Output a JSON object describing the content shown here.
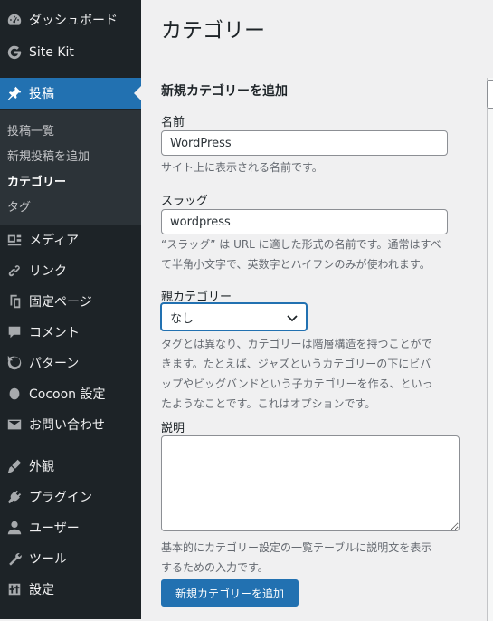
{
  "sidebar": {
    "items": [
      {
        "label": "ダッシュボード",
        "icon": "dashboard-icon"
      },
      {
        "label": "Site Kit",
        "icon": "sitekit-icon"
      },
      {
        "label": "投稿",
        "icon": "pin-icon",
        "active": true
      },
      {
        "label": "メディア",
        "icon": "media-icon"
      },
      {
        "label": "リンク",
        "icon": "link-icon"
      },
      {
        "label": "固定ページ",
        "icon": "page-icon"
      },
      {
        "label": "コメント",
        "icon": "comment-icon"
      },
      {
        "label": "パターン",
        "icon": "pattern-icon"
      },
      {
        "label": "Cocoon 設定",
        "icon": "cocoon-icon"
      },
      {
        "label": "お問い合わせ",
        "icon": "mail-icon"
      },
      {
        "label": "外観",
        "icon": "appearance-icon"
      },
      {
        "label": "プラグイン",
        "icon": "plugin-icon"
      },
      {
        "label": "ユーザー",
        "icon": "user-icon"
      },
      {
        "label": "ツール",
        "icon": "tools-icon"
      },
      {
        "label": "設定",
        "icon": "settings-icon"
      }
    ],
    "submenu": [
      {
        "label": "投稿一覧"
      },
      {
        "label": "新規投稿を追加"
      },
      {
        "label": "カテゴリー",
        "current": true
      },
      {
        "label": "タグ"
      }
    ]
  },
  "main": {
    "title": "カテゴリー",
    "form_heading": "新規カテゴリーを追加",
    "name": {
      "label": "名前",
      "value": "WordPress",
      "help": "サイト上に表示される名前です。"
    },
    "slug": {
      "label": "スラッグ",
      "value": "wordpress",
      "help_line1": "“スラッグ” は URL に適した形式の名前です。通常はすべ",
      "help_line2": "て半角小文字で、英数字とハイフンのみが使われます。"
    },
    "parent": {
      "label": "親カテゴリー",
      "selected": "なし",
      "help_line1": "タグとは異なり、カテゴリーは階層構造を持つことがで",
      "help_line2": "きます。たとえば、ジャズというカテゴリーの下にビバ",
      "help_line3": "ップやビッグバンドという子カテゴリーを作る、といっ",
      "help_line4": "たようなことです。これはオプションです。"
    },
    "description": {
      "label": "説明",
      "value": "",
      "help_line1": "基本的にカテゴリー設定の一覧テーブルに説明文を表示",
      "help_line2": "するための入力です。"
    },
    "submit_label": "新規カテゴリーを追加"
  },
  "colors": {
    "sidebar_bg": "#1d2327",
    "submenu_bg": "#2c3338",
    "accent": "#2271b1",
    "page_bg": "#f0f0f1"
  }
}
